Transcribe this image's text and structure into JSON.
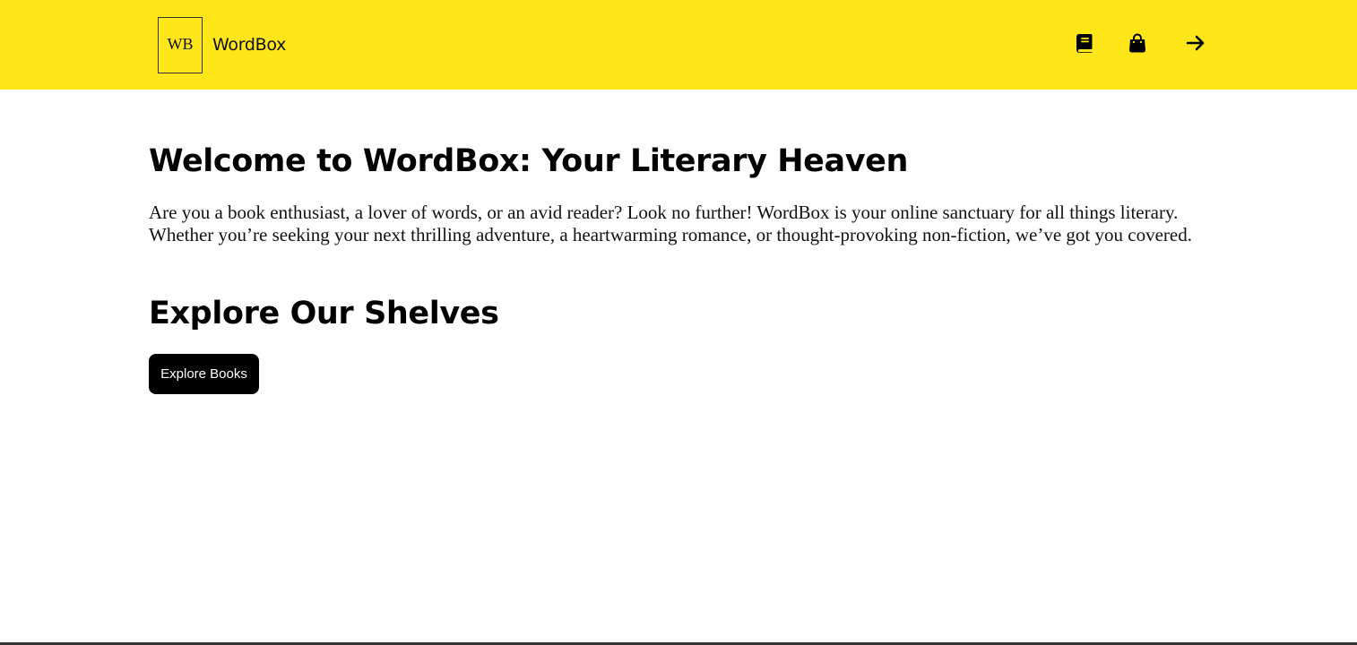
{
  "header": {
    "logo_mark": "WB",
    "logo_text": "WordBox",
    "background_color": "#ffe619",
    "icons": [
      "book-icon",
      "shopping-bag-icon",
      "arrow-right-icon"
    ]
  },
  "main": {
    "title": "Welcome to WordBox: Your Literary Heaven",
    "intro": "Are you a book enthusiast, a lover of words, or an avid reader? Look no further! WordBox is your online sanctuary for all things literary. Whether you’re seeking your next thrilling adventure, a heartwarming romance, or thought-provoking non-fiction, we’ve got you covered.",
    "section_title": "Explore Our Shelves",
    "cta_label": "Explore Books"
  }
}
